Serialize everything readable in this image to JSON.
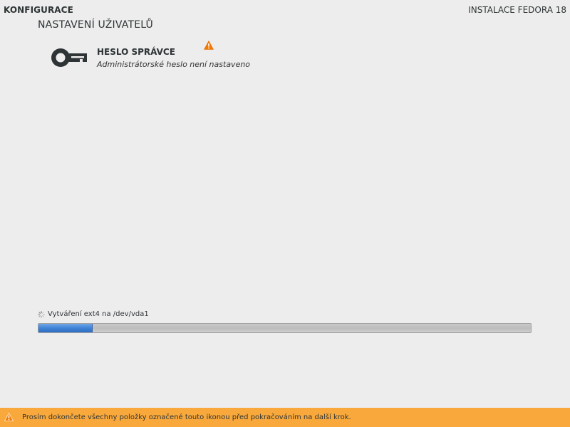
{
  "header": {
    "left_title": "KONFIGURACE",
    "right_title": "INSTALACE FEDORA 18"
  },
  "section": {
    "title": "NASTAVENÍ UŽIVATELŮ"
  },
  "spokes": [
    {
      "title": "HESLO SPRÁVCE",
      "status": "Administrátorské heslo není nastaveno",
      "icon": "key-icon",
      "warning_icon": "warning-icon"
    }
  ],
  "progress": {
    "label": "Vytváření ext4 na /dev/vda1",
    "icon": "spinner-icon",
    "fraction": 0.11
  },
  "warning_bar": {
    "icon": "warning-icon",
    "message": "Prosím dokončete všechny položky označené touto ikonou před pokračováním na další krok."
  },
  "colors": {
    "background": "#ededed",
    "warning_bar": "#f9a93c",
    "warning_icon": "#f57900",
    "progress_fill": "#3f82d6",
    "text": "#2e3436"
  }
}
